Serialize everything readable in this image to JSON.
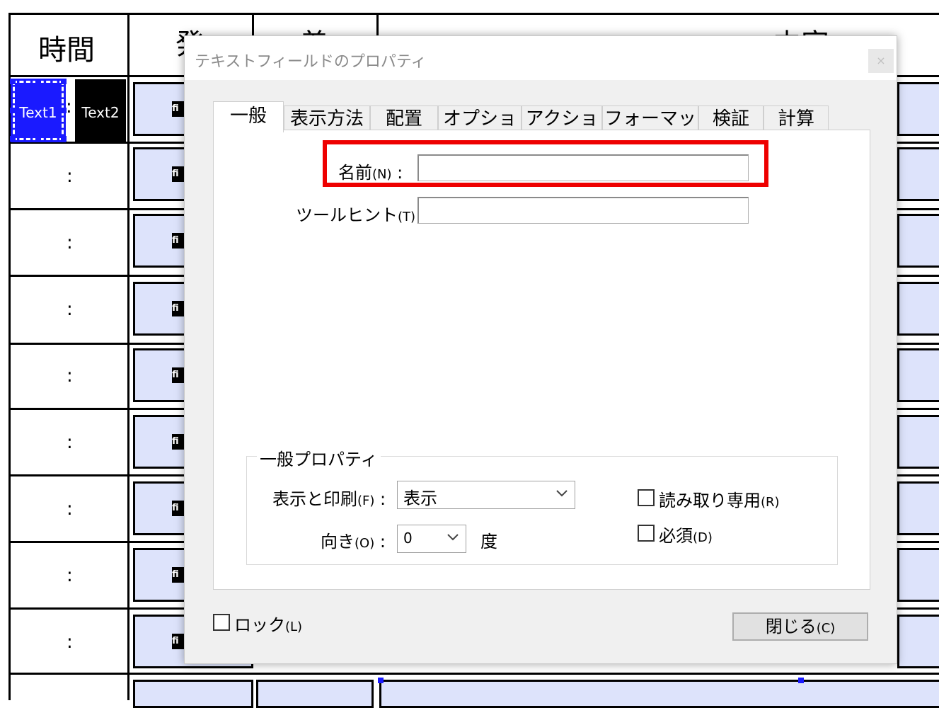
{
  "background_form": {
    "header": {
      "col_time": "時間",
      "col_2": "発",
      "col_3": "着",
      "col_content": "内容"
    },
    "text_fields": [
      "Text1",
      "Text2"
    ],
    "colon": ":",
    "field_icon": "fi"
  },
  "dialog": {
    "title": "テキストフィールドのプロパティ",
    "close_label": "×",
    "tabs": [
      {
        "label": "一般"
      },
      {
        "label": "表示方法"
      },
      {
        "label": "配置"
      },
      {
        "label": "オプション"
      },
      {
        "label": "アクション"
      },
      {
        "label": "フォーマット"
      },
      {
        "label": "検証"
      },
      {
        "label": "計算"
      }
    ],
    "active_tab": "一般",
    "fields": {
      "name_label": "名前",
      "name_accel": "(N)",
      "name_suffix": " :",
      "name_value": "",
      "tooltip_label": "ツールヒント",
      "tooltip_accel": "(T)",
      "tooltip_suffix": " :",
      "tooltip_value": ""
    },
    "group": {
      "title": "一般プロパティ",
      "display_print_label": "表示と印刷",
      "display_print_accel": "(F)",
      "display_print_suffix": " :",
      "display_print_value": "表示",
      "orientation_label": "向き",
      "orientation_accel": "(O)",
      "orientation_suffix": " :",
      "orientation_value": "0",
      "orientation_unit": "度",
      "readonly_label": "読み取り専用",
      "readonly_accel": "(R)",
      "required_label": "必須",
      "required_accel": "(D)"
    },
    "lock_label": "ロック",
    "lock_accel": "(L)",
    "close_button_label": "閉じる",
    "close_button_accel": "(C)"
  },
  "colors": {
    "highlight": "#ee0000",
    "field_fill": "#dde3fb",
    "selection": "#1a1aff"
  },
  "icons": [
    "close-icon",
    "chevron-down-icon",
    "field-icon"
  ]
}
